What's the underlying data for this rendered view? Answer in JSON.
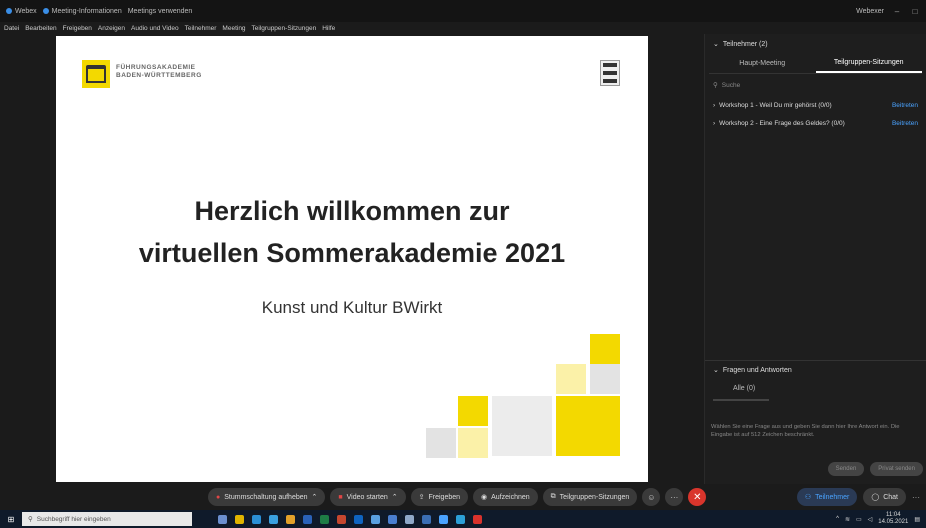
{
  "titlebar": {
    "app": "Webex",
    "tab_meeting": "Meeting-Informationen",
    "tab_extra": "Meetings verwenden",
    "user": "Webexer"
  },
  "menu": [
    "Datei",
    "Bearbeiten",
    "Freigeben",
    "Anzeigen",
    "Audio und Video",
    "Teilnehmer",
    "Meeting",
    "Teilgruppen-Sitzungen",
    "Hilfe"
  ],
  "slide": {
    "logo_line1": "FÜHRUNGSAKADEMIE",
    "logo_line2": "BADEN-WÜRTTEMBERG",
    "headline_line1": "Herzlich willkommen zur",
    "headline_line2": "virtuellen Sommerakademie 2021",
    "subline": "Kunst und Kultur BWirkt",
    "accent": "#f3d900"
  },
  "panel": {
    "participants": "Teilnehmer (2)",
    "tab_main": "Haupt-Meeting",
    "tab_breakout": "Teilgruppen-Sitzungen",
    "search_placeholder": "Suche",
    "rooms": [
      {
        "name": "Workshop 1 - Weil Du mir gehörst (0/0)",
        "join": "Beitreten"
      },
      {
        "name": "Workshop 2 - Eine Frage des Geldes? (0/0)",
        "join": "Beitreten"
      }
    ],
    "qa_title": "Fragen und Antworten",
    "qa_all": "Alle (0)",
    "qa_help": "Wählen Sie eine Frage aus und geben Sie dann hier Ihre Antwort ein. Die Eingabe ist auf 512 Zeichen beschränkt.",
    "qa_send": "Senden",
    "qa_send_private": "Privat senden"
  },
  "controls": {
    "mute": "Stummschaltung aufheben",
    "video": "Video starten",
    "share": "Freigeben",
    "record": "Aufzeichnen",
    "breakout": "Teilgruppen-Sitzungen",
    "participants": "Teilnehmer",
    "chat": "Chat"
  },
  "taskbar": {
    "search_placeholder": "Suchbegriff hier eingeben",
    "time": "11:04",
    "date": "14.05.2021"
  }
}
